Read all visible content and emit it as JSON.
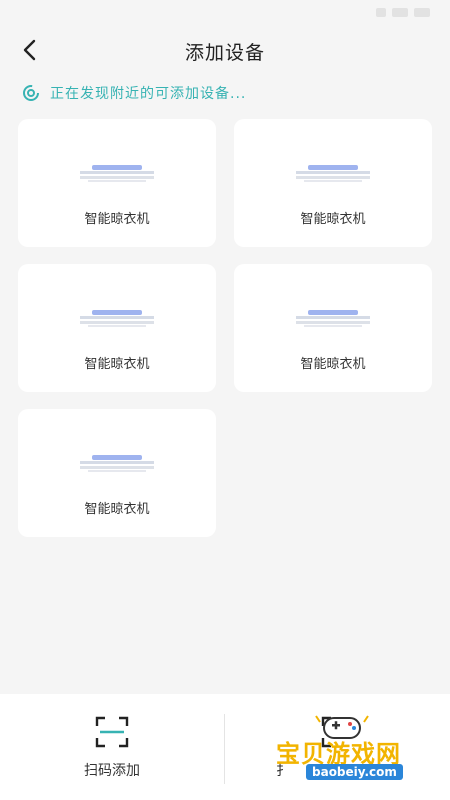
{
  "header": {
    "title": "添加设备"
  },
  "scan": {
    "status_text": "正在发现附近的可添加设备..."
  },
  "devices": [
    {
      "name": "智能晾衣机"
    },
    {
      "name": "智能晾衣机"
    },
    {
      "name": "智能晾衣机"
    },
    {
      "name": "智能晾衣机"
    },
    {
      "name": "智能晾衣机"
    }
  ],
  "bottom_bar": {
    "scan_add_label": "扫码添加",
    "second_label_visible": "扌"
  },
  "watermark": {
    "text": "宝贝游戏网",
    "url": "baobeiy.com"
  },
  "colors": {
    "accent": "#37b3b3",
    "background": "#f5f5f5",
    "card": "#ffffff"
  }
}
